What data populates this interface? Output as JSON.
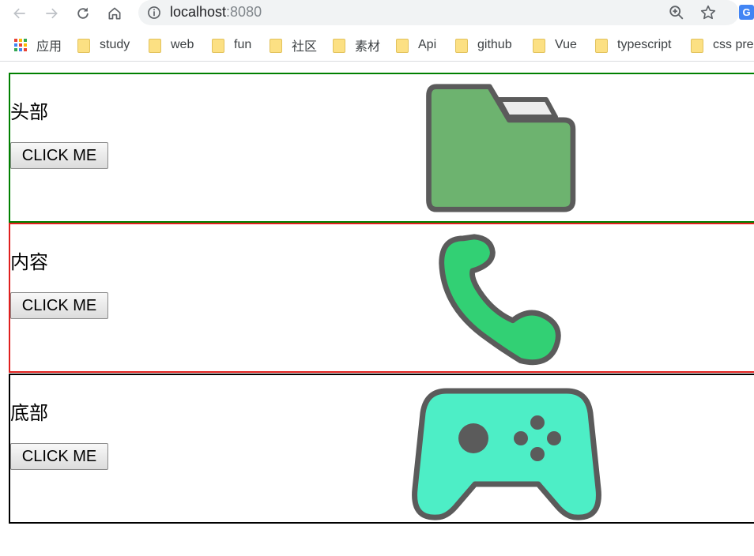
{
  "browser": {
    "url_host": "localhost",
    "url_port": ":8080",
    "icons": [
      "back-arrow-icon",
      "forward-arrow-icon",
      "reload-icon",
      "home-icon",
      "site-info-icon",
      "zoom-icon",
      "star-icon",
      "translate-icon"
    ]
  },
  "bookmarks": {
    "apps_label": "应用",
    "items": [
      {
        "label": "study"
      },
      {
        "label": "web"
      },
      {
        "label": "fun"
      },
      {
        "label": "社区"
      },
      {
        "label": "素材"
      },
      {
        "label": "Api"
      },
      {
        "label": "github"
      },
      {
        "label": "Vue"
      },
      {
        "label": "typescript"
      },
      {
        "label": "css pre"
      }
    ]
  },
  "sections": [
    {
      "title": "头部",
      "button_label": "CLICK ME",
      "icon": "folder-icon",
      "border_color": "#008000",
      "icon_color": "#6db36f"
    },
    {
      "title": "内容",
      "button_label": "CLICK ME",
      "icon": "phone-icon",
      "border_color": "#e0201e",
      "icon_color": "#32d074"
    },
    {
      "title": "底部",
      "button_label": "CLICK ME",
      "icon": "gamepad-icon",
      "border_color": "#000000",
      "icon_color": "#4deec6"
    }
  ],
  "colors": {
    "icon_outline": "#5b5b5b"
  }
}
